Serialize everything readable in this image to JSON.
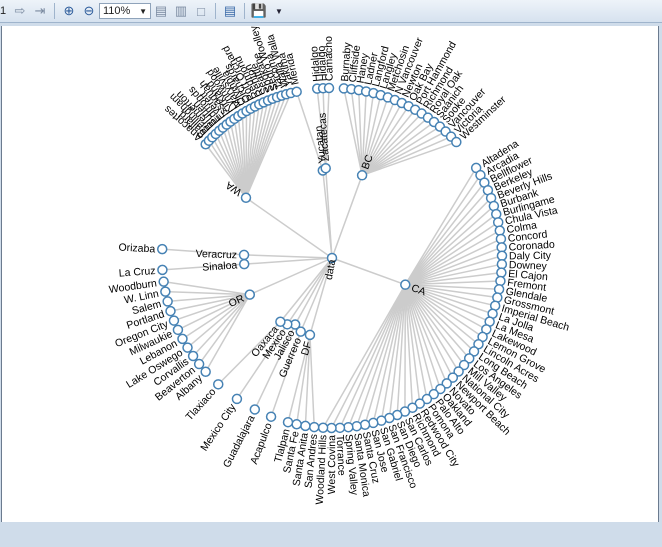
{
  "toolbar": {
    "page_number": "1",
    "zoom_value": "110%"
  },
  "tree": {
    "root": "data",
    "groups": [
      {
        "name": "WA",
        "children": [
          "Anacortes",
          "Ballard",
          "Bellingham",
          "Bremerton",
          "Burien",
          "Edmonds",
          "Everett",
          "Issaquah",
          "Kirkland",
          "Lynnwood",
          "Marysville",
          "Olympia",
          "Orchards",
          "Port Orchard",
          "Redmond",
          "Renton",
          "Seattle",
          "Spokane",
          "Sedro Woolley",
          "Tacoma",
          "Walla Walla",
          "Yakima"
        ]
      },
      {
        "name": "Merida",
        "children": []
      },
      {
        "name": "Yucatan",
        "children": [
          "Merida"
        ]
      },
      {
        "name": "Zacatecas",
        "children": [
          "Hidalgo",
          "Hidalgo",
          "Camacho"
        ]
      },
      {
        "name": "BC",
        "children": [
          "Burnaby",
          "Cliffside",
          "Haney",
          "Ladner",
          "Langford",
          "Langley",
          "Metchosin",
          "N Vancouver",
          "Newton",
          "Oak Bay",
          "Port Hammond",
          "Richmond",
          "Royal Oak",
          "Saanich",
          "Sooke",
          "Vancouver",
          "Victoria",
          "Westminster"
        ]
      },
      {
        "name": "CA",
        "children": [
          "Altadena",
          "Arcadia",
          "Bellflower",
          "Berkeley",
          "Beverly Hills",
          "Burbank",
          "Burlingame",
          "Chula Vista",
          "Colma",
          "Concord",
          "Coronado",
          "Daly City",
          "Downey",
          "El Cajon",
          "Fremont",
          "Glendale",
          "Grossmont",
          "Imperial Beach",
          "La Jolla",
          "La Mesa",
          "Lakewood",
          "Lemon Grove",
          "Lincoln Acres",
          "Long Beach",
          "Los Angeles",
          "Mill Valley",
          "National City",
          "Newport Beach",
          "Novato",
          "Oakland",
          "Palo Alto",
          "Pomona",
          "Redwood City",
          "Richmond",
          "San Carlos",
          "San Diego",
          "San Francisco",
          "San Gabriel",
          "San Jose",
          "Santa Cruz",
          "Santa Monica",
          "Spring Valley",
          "Torrance",
          "West Covina",
          "Woodland Hills"
        ]
      },
      {
        "name": "DF",
        "children": [
          "San Andres",
          "Santa Anita",
          "Santa Fe",
          "Tlalpan"
        ]
      },
      {
        "name": "Guerrero",
        "children": [
          "Acapulco"
        ]
      },
      {
        "name": "Jalisco",
        "children": [
          "Guadalajara"
        ]
      },
      {
        "name": "Mexico",
        "children": [
          "Mexico City"
        ]
      },
      {
        "name": "Oaxaca",
        "children": [
          "Tlaxiaco"
        ]
      },
      {
        "name": "OR",
        "children": [
          "Albany",
          "Beaverton",
          "Corvallis",
          "Lake Oswego",
          "Lebanon",
          "Milwaukie",
          "Oregon City",
          "Portland",
          "Salem",
          "W. Linn",
          "Woodburn"
        ]
      },
      {
        "name": "La Cruz",
        "children": []
      },
      {
        "name": "Sinaloa",
        "children": [
          "La Cruz"
        ]
      },
      {
        "name": "Veracruz",
        "children": [
          "Orizaba"
        ]
      }
    ]
  },
  "labels": {
    "WA": "WA",
    "BC": "BC",
    "CA": "CA",
    "OR": "OR",
    "DF": "DF",
    "data": "data",
    "Yucatan": "Yucatan",
    "Zacatecas": "Zacatecas",
    "Guerrero": "Guerrero",
    "Jalisco": "Jalisco",
    "Mexico": "Mexico",
    "Oaxaca": "Oaxaca",
    "Veracruz": "Veracruz",
    "Sinaloa": "Sinaloa"
  },
  "colors": {
    "node_stroke": "#4682b4",
    "link": "#cccccc"
  }
}
